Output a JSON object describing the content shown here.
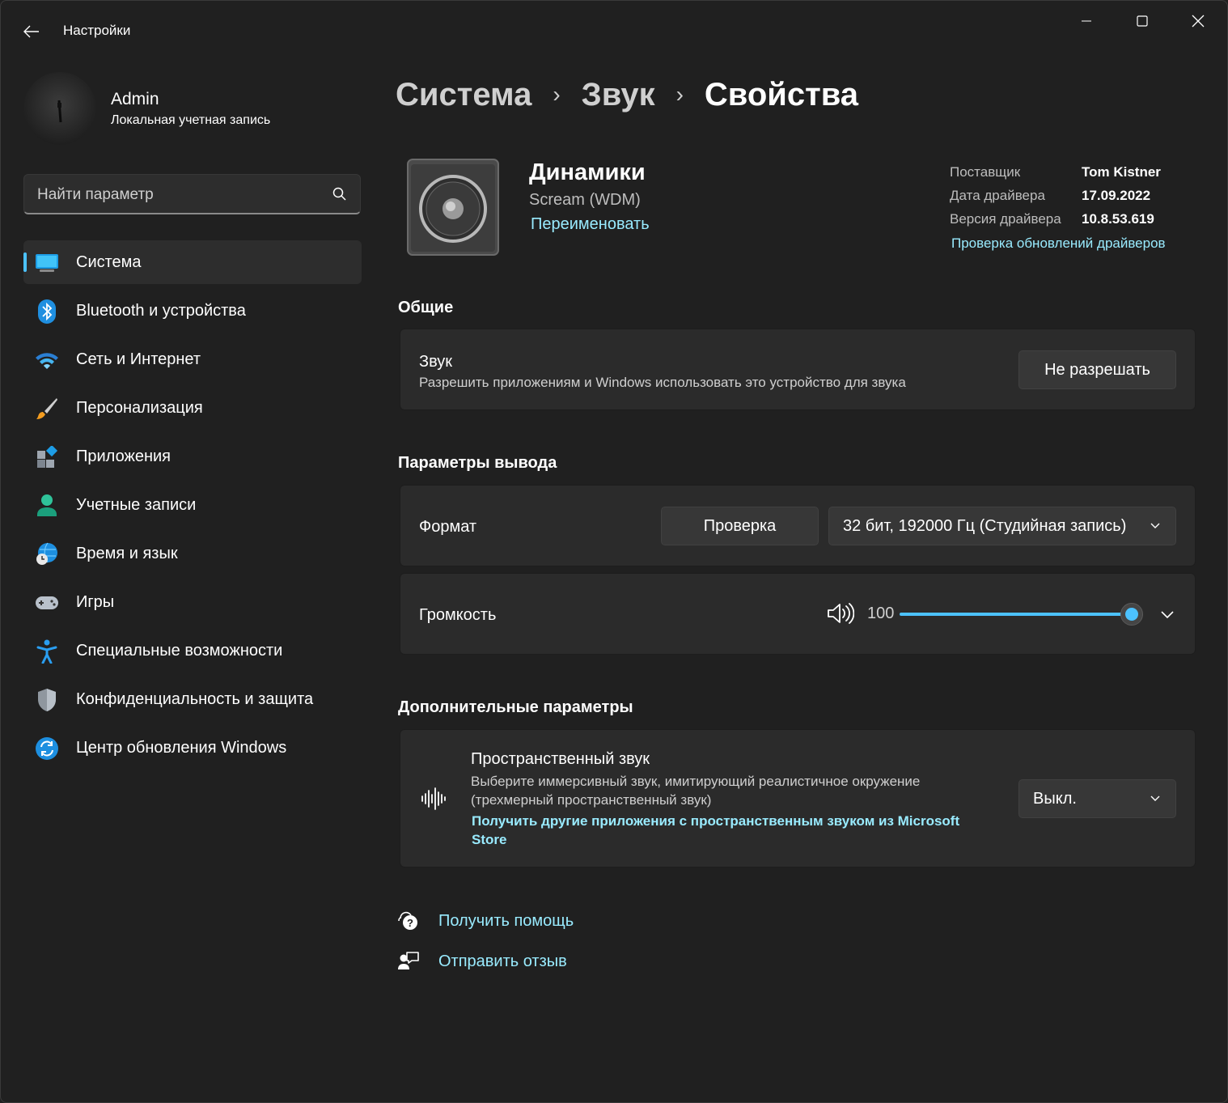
{
  "window": {
    "title": "Настройки",
    "controls": {
      "minimize": "minimize",
      "maximize": "maximize",
      "close": "close"
    }
  },
  "user": {
    "name": "Admin",
    "account_type": "Локальная учетная запись"
  },
  "search": {
    "placeholder": "Найти параметр"
  },
  "sidebar": {
    "items": [
      {
        "label": "Система",
        "icon": "system-icon",
        "active": true
      },
      {
        "label": "Bluetooth и устройства",
        "icon": "bluetooth-icon"
      },
      {
        "label": "Сеть и Интернет",
        "icon": "wifi-icon"
      },
      {
        "label": "Персонализация",
        "icon": "brush-icon"
      },
      {
        "label": "Приложения",
        "icon": "apps-icon"
      },
      {
        "label": "Учетные записи",
        "icon": "accounts-icon"
      },
      {
        "label": "Время и язык",
        "icon": "time-language-icon"
      },
      {
        "label": "Игры",
        "icon": "gamepad-icon"
      },
      {
        "label": "Специальные возможности",
        "icon": "accessibility-icon"
      },
      {
        "label": "Конфиденциальность и защита",
        "icon": "shield-icon"
      },
      {
        "label": "Центр обновления Windows",
        "icon": "update-icon"
      }
    ]
  },
  "breadcrumb": {
    "items": [
      "Система",
      "Звук",
      "Свойства"
    ],
    "separator": "›"
  },
  "device": {
    "name": "Динамики",
    "subtitle": "Scream (WDM)",
    "rename": "Переименовать",
    "info": [
      {
        "label": "Поставщик",
        "value": "Tom Kistner"
      },
      {
        "label": "Дата драйвера",
        "value": "17.09.2022"
      },
      {
        "label": "Версия драйвера",
        "value": "10.8.53.619"
      }
    ],
    "driver_update_link": "Проверка обновлений драйверов"
  },
  "general": {
    "section_title": "Общие",
    "sound_title": "Звук",
    "sound_desc": "Разрешить приложениям и Windows использовать это устройство для звука",
    "disallow_button": "Не разрешать"
  },
  "output": {
    "section_title": "Параметры вывода",
    "format_label": "Формат",
    "test_button": "Проверка",
    "format_value": "32 бит, 192000 Гц (Студийная запись)",
    "volume_label": "Громкость",
    "volume_value": "100",
    "volume_level_percent": 100
  },
  "advanced": {
    "section_title": "Дополнительные параметры",
    "spatial_title": "Пространственный звук",
    "spatial_desc": "Выберите иммерсивный звук, имитирующий реалистичное окружение (трехмерный пространственный звук)",
    "store_link": "Получить другие приложения с пространственным звуком из Microsoft Store",
    "spatial_value": "Выкл."
  },
  "footer": {
    "help": "Получить помощь",
    "feedback": "Отправить отзыв"
  },
  "colors": {
    "accent": "#4cc2ff",
    "link": "#99ebff",
    "background": "#202020",
    "card": "#2b2b2b"
  }
}
